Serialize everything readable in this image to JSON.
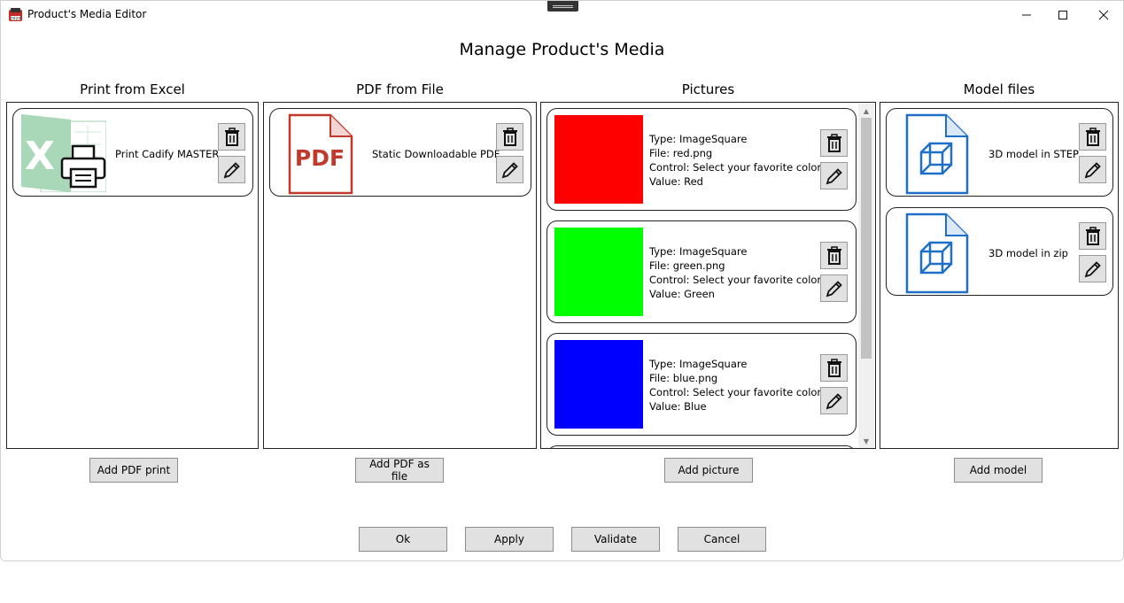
{
  "window": {
    "title": "Product's Media Editor",
    "controls": {
      "minimize": "—",
      "maximize": "☐",
      "close": "✕"
    }
  },
  "page": {
    "title": "Manage Product's Media"
  },
  "columns": {
    "excel": {
      "title": "Print from Excel",
      "add_label": "Add PDF print"
    },
    "pdf": {
      "title": "PDF from File",
      "add_label": "Add PDF as file"
    },
    "pictures": {
      "title": "Pictures",
      "add_label": "Add picture"
    },
    "models": {
      "title": "Model files",
      "add_label": "Add model"
    }
  },
  "excel_items": [
    {
      "label": "Print Cadify MASTER"
    }
  ],
  "pdf_items": [
    {
      "label": "Static Downloadable PDF",
      "icon_text": "PDF"
    }
  ],
  "picture_items": [
    {
      "type": "Type: ImageSquare",
      "file": "File: red.png",
      "control": "Control: Select your favorite color",
      "value": "Value: Red",
      "color": "#ff0000"
    },
    {
      "type": "Type: ImageSquare",
      "file": "File: green.png",
      "control": "Control: Select your favorite color",
      "value": "Value: Green",
      "color": "#00ff00"
    },
    {
      "type": "Type: ImageSquare",
      "file": "File: blue.png",
      "control": "Control: Select your favorite color",
      "value": "Value: Blue",
      "color": "#0000ff"
    }
  ],
  "model_items": [
    {
      "label": "3D model in STEP"
    },
    {
      "label": "3D model in zip"
    }
  ],
  "footer": {
    "ok": "Ok",
    "apply": "Apply",
    "validate": "Validate",
    "cancel": "Cancel"
  },
  "colors": {
    "excel_green": "#21a366",
    "pdf_red": "#c0392b",
    "model_blue": "#1f6fc6"
  }
}
